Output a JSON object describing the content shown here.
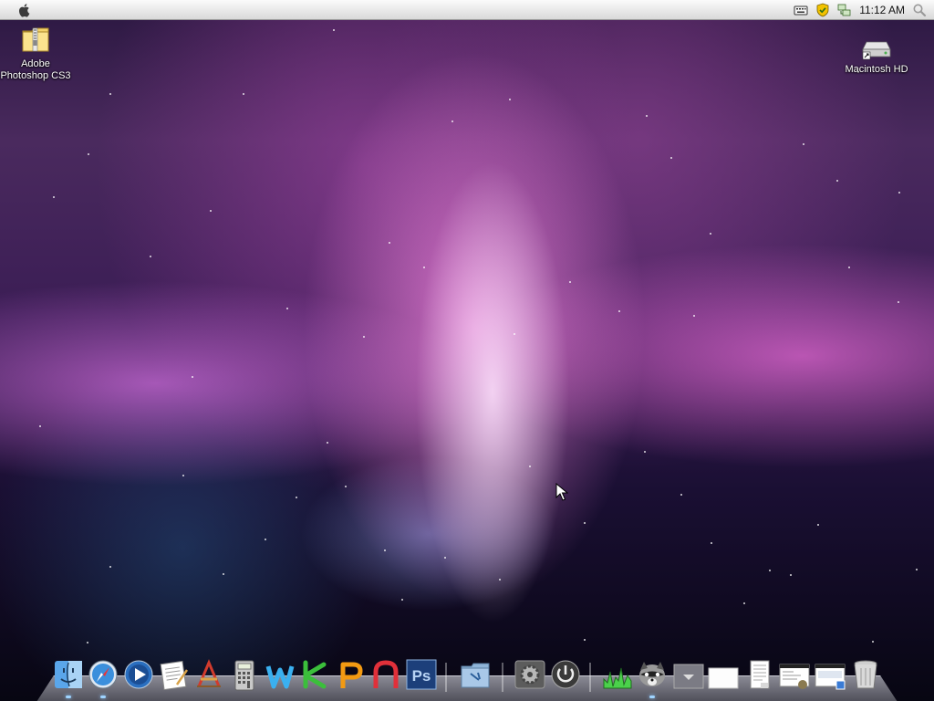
{
  "menubar": {
    "clock": "11:12 AM",
    "icons": [
      "apple-icon",
      "keyboard-icon",
      "security-shield-icon",
      "network-icon",
      "spotlight-search-icon"
    ]
  },
  "desktop": {
    "icons": [
      {
        "label": "Adobe Photoshop CS3",
        "icon": "zip-folder-icon"
      },
      {
        "label": "Macintosh HD",
        "icon": "hard-drive-icon"
      }
    ]
  },
  "dock": {
    "items": [
      {
        "name": "finder",
        "icon": "finder-icon",
        "running": true
      },
      {
        "name": "safari",
        "icon": "safari-icon",
        "running": true
      },
      {
        "name": "media-player",
        "icon": "play-icon",
        "running": false
      },
      {
        "name": "textedit",
        "icon": "textedit-icon",
        "running": false
      },
      {
        "name": "app-store",
        "icon": "app-store-icon",
        "running": false
      },
      {
        "name": "calculator",
        "icon": "calculator-icon",
        "running": false
      },
      {
        "name": "word",
        "icon": "word-icon",
        "running": false
      },
      {
        "name": "excel",
        "icon": "excel-icon",
        "running": false
      },
      {
        "name": "powerpoint",
        "icon": "powerpoint-icon",
        "running": false
      },
      {
        "name": "access",
        "icon": "access-icon",
        "running": false
      },
      {
        "name": "photoshop",
        "icon": "photoshop-icon",
        "running": false
      },
      {
        "name": "documents",
        "icon": "folder-icon",
        "running": false
      },
      {
        "name": "system-preferences",
        "icon": "gear-icon",
        "running": false
      },
      {
        "name": "shut-down",
        "icon": "power-icon",
        "running": false
      },
      {
        "name": "activity-monitor",
        "icon": "activity-monitor-icon",
        "running": false
      },
      {
        "name": "raccoon",
        "icon": "raccoon-icon",
        "running": true
      },
      {
        "name": "stack",
        "icon": "stack-icon",
        "running": false
      },
      {
        "name": "blank-window",
        "icon": "window-icon",
        "running": false
      },
      {
        "name": "document-preview",
        "icon": "document-icon",
        "running": false
      },
      {
        "name": "window-thumb-1",
        "icon": "window-thumbnail-icon",
        "running": false
      },
      {
        "name": "window-thumb-2",
        "icon": "window-thumbnail-icon",
        "running": false
      },
      {
        "name": "trash",
        "icon": "trash-icon",
        "running": false
      }
    ]
  },
  "colors": {
    "menubar": "#e8e8e8",
    "photoshop": "#1c3f7a",
    "wallpaper_accent": "#e07ad8"
  }
}
